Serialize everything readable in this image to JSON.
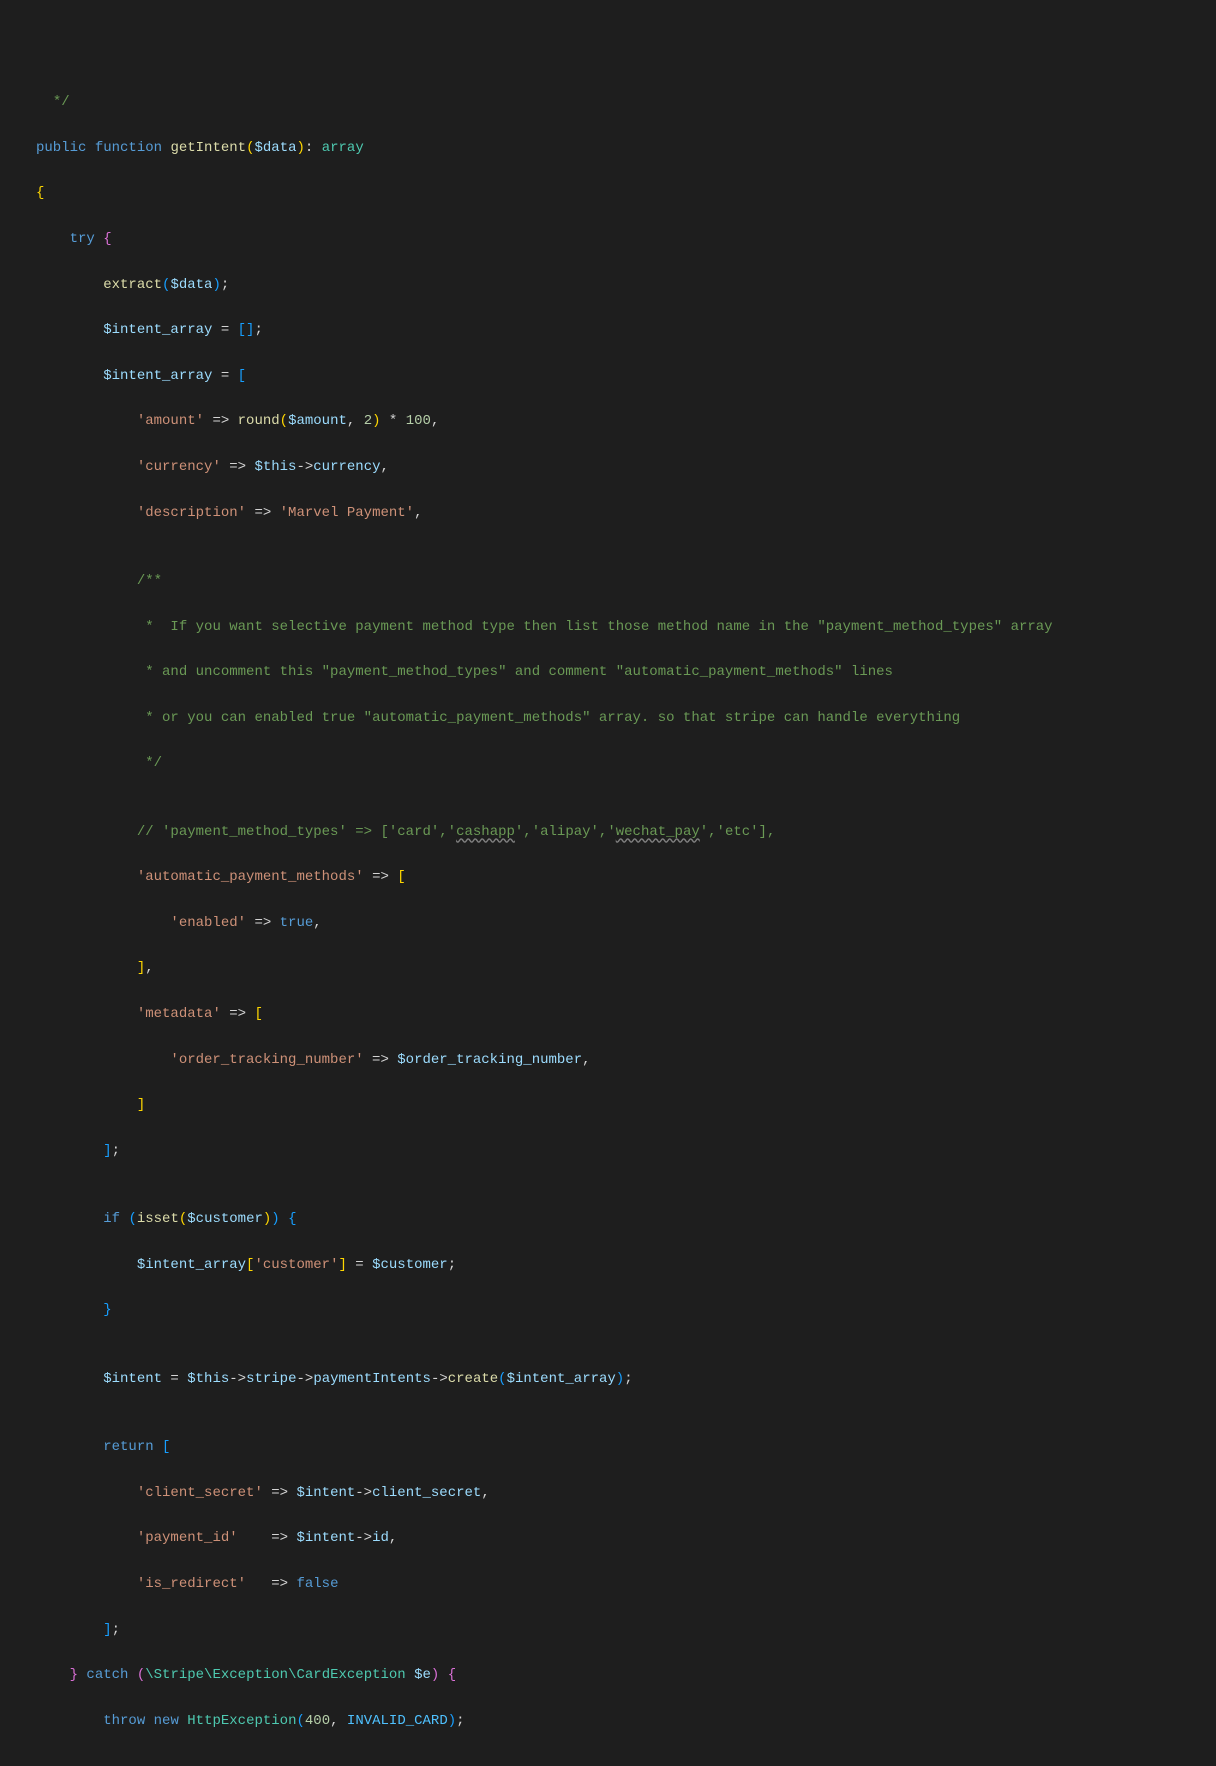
{
  "tokens": {
    "l1_comment_end": "*/",
    "l2_public": "public",
    "l2_function": "function",
    "l2_fn": "getIntent",
    "l2_data": "$data",
    "l2_array": "array",
    "l4_try": "try",
    "l5_extract": "extract",
    "l5_data": "$data",
    "l6_intent_array": "$intent_array",
    "l7_intent_array": "$intent_array",
    "l8_amount_key": "'amount'",
    "l8_round": "round",
    "l8_amount_var": "$amount",
    "l8_two": "2",
    "l8_hundred": "100",
    "l9_currency_key": "'currency'",
    "l9_this": "$this",
    "l9_currency": "currency",
    "l10_desc_key": "'description'",
    "l10_desc_val": "'Marvel Payment'",
    "l12_doc0": "/**",
    "l12_doc1": " *  If you want selective payment method type then list those method name in the \"payment_method_types\" array",
    "l12_doc2": " * and uncomment this \"payment_method_types\" and comment \"automatic_payment_methods\" lines",
    "l12_doc3": " * or you can enabled true \"automatic_payment_methods\" array. so that stripe can handle everything",
    "l12_doc4": " */",
    "l18_comment_pre": "// 'payment_method_types' => ['card','",
    "l18_cashapp": "cashapp",
    "l18_mid1": "','alipay','",
    "l18_wechat": "wechat_pay",
    "l18_post": "','etc'],",
    "l19_apm_key": "'automatic_payment_methods'",
    "l20_enabled_key": "'enabled'",
    "l20_true": "true",
    "l22_metadata_key": "'metadata'",
    "l23_otn_key": "'order_tracking_number'",
    "l23_otn_var": "$order_tracking_number",
    "l27_if": "if",
    "l27_isset": "isset",
    "l27_customer": "$customer",
    "l28_intent_array": "$intent_array",
    "l28_customer_key": "'customer'",
    "l28_customer_var": "$customer",
    "l31_intent": "$intent",
    "l31_this": "$this",
    "l31_stripe": "stripe",
    "l31_pi": "paymentIntents",
    "l31_create": "create",
    "l31_intent_array": "$intent_array",
    "l33_return": "return",
    "l34_cs_key": "'client_secret'",
    "l34_intent": "$intent",
    "l34_client_secret": "client_secret",
    "l35_pid_key": "'payment_id'",
    "l35_intent": "$intent",
    "l35_id": "id",
    "l36_ir_key": "'is_redirect'",
    "l36_false": "false",
    "l38_catch": "catch",
    "l38_ns1": "\\Stripe\\Exception\\",
    "l38_cardexception": "CardException",
    "l38_e": "$e",
    "l39_throw": "throw",
    "l39_new": "new",
    "l39_httpexc": "HttpException",
    "l39_400": "400",
    "l39_invalid": "INVALID_CARD"
  }
}
